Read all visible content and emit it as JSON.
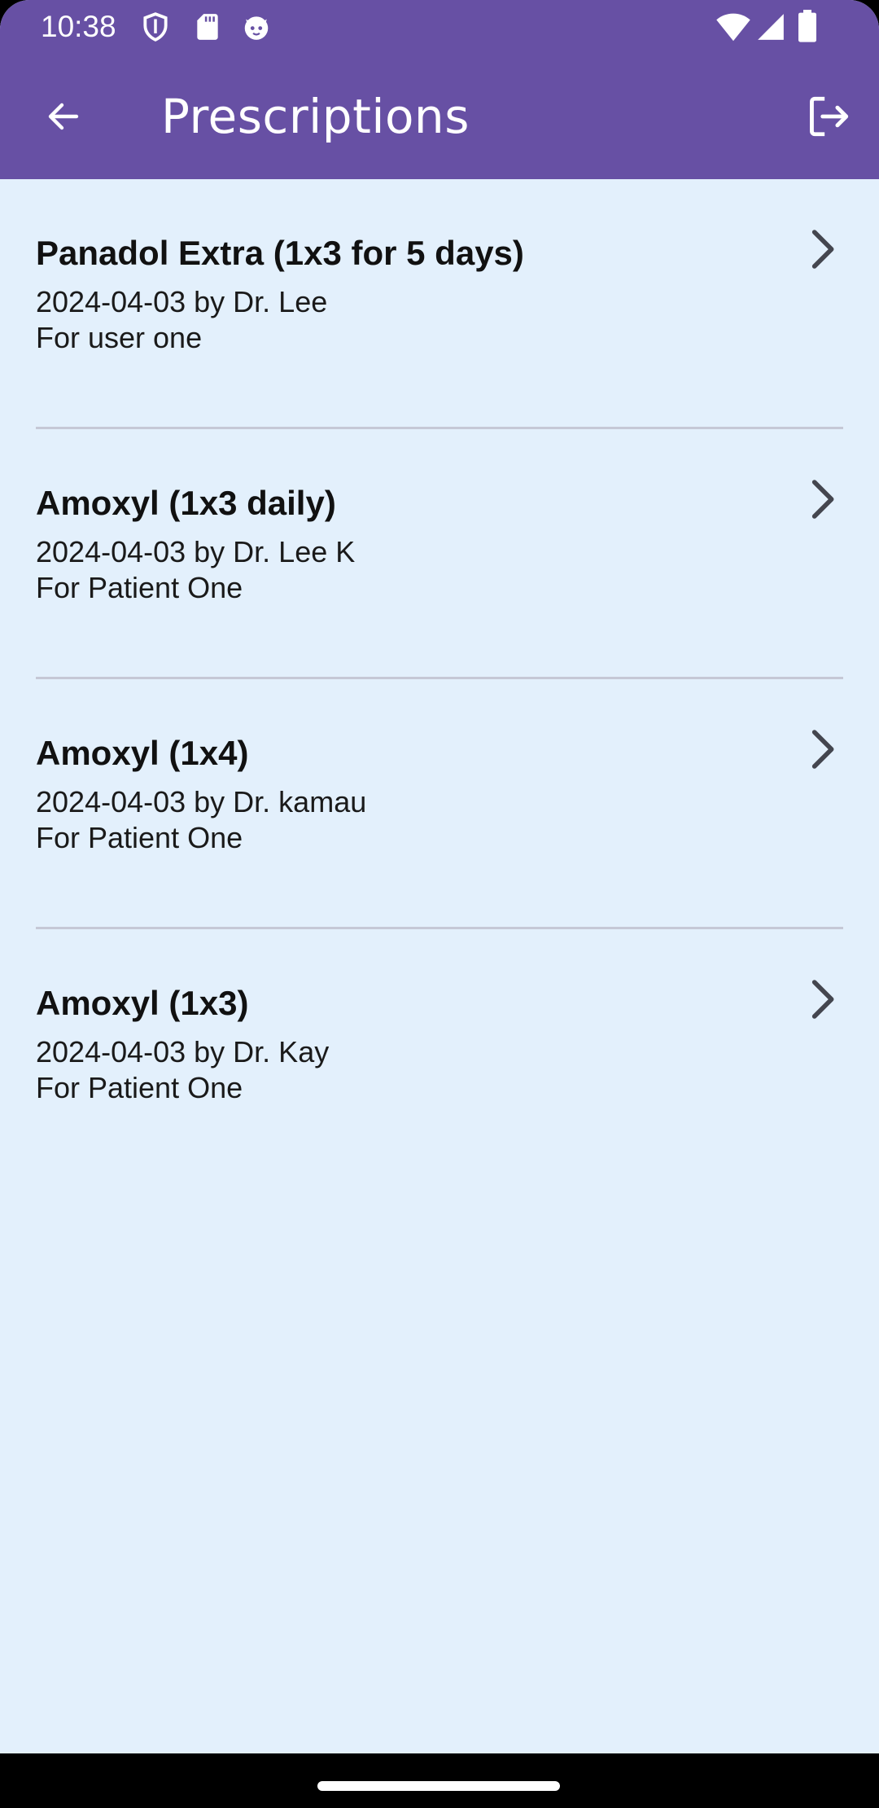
{
  "status_bar": {
    "time": "10:38",
    "icons_left": [
      "shield-icon",
      "sd-card-icon",
      "cat-face-icon"
    ],
    "icons_right": [
      "wifi-icon",
      "cellular-signal-icon",
      "battery-icon"
    ]
  },
  "app_bar": {
    "title": "Prescriptions",
    "back_icon": "arrow-back-icon",
    "logout_icon": "logout-icon"
  },
  "colors": {
    "primary": "#6750A4",
    "background": "#E3F0FC",
    "divider": "#C5C8D6",
    "text": "#111111",
    "chevron": "#44464F"
  },
  "prescriptions": [
    {
      "title": "Panadol Extra (1x3 for 5 days)",
      "line1": "2024-04-03 by Dr. Lee",
      "line2": "For user one"
    },
    {
      "title": "Amoxyl (1x3 daily)",
      "line1": "2024-04-03 by Dr. Lee K",
      "line2": "For Patient One"
    },
    {
      "title": "Amoxyl (1x4)",
      "line1": "2024-04-03 by Dr. kamau",
      "line2": "For Patient One"
    },
    {
      "title": "Amoxyl (1x3)",
      "line1": "2024-04-03 by Dr. Kay",
      "line2": "For Patient One"
    }
  ]
}
